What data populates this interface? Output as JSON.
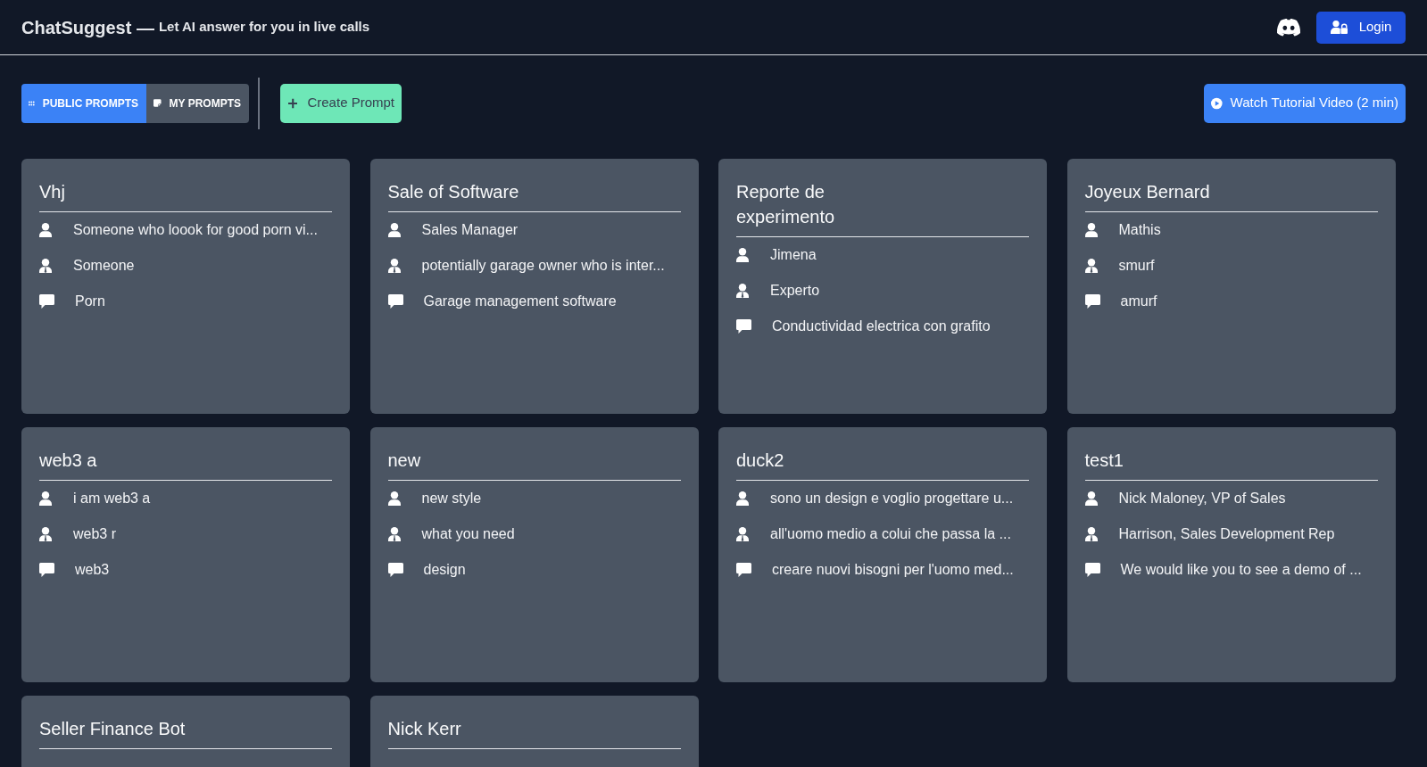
{
  "header": {
    "brand": "ChatSuggest —",
    "tagline": "Let AI answer for you in live calls",
    "login_button": "Login"
  },
  "toolbar": {
    "tabs": [
      {
        "label": "PUBLIC PROMPTS",
        "kind": "grid",
        "selected": true
      },
      {
        "label": "MY PROMPTS",
        "kind": "note",
        "selected": false
      }
    ],
    "create_button": "Create Prompt",
    "tutorial_button": "Watch Tutorial Video (2 min)"
  },
  "prompts": [
    {
      "title": "Vhj",
      "lines": [
        {
          "kind": "user",
          "text": "Someone who loook for good porn vi..."
        },
        {
          "kind": "persona",
          "text": "Someone"
        },
        {
          "kind": "topic",
          "text": "Porn"
        }
      ]
    },
    {
      "title": "Sale of Software",
      "lines": [
        {
          "kind": "user",
          "text": "Sales Manager"
        },
        {
          "kind": "persona",
          "text": "potentially garage owner who is inter..."
        },
        {
          "kind": "topic",
          "text": "Garage management software"
        }
      ]
    },
    {
      "title": "Reporte de experimento",
      "lines": [
        {
          "kind": "user",
          "text": "Jimena"
        },
        {
          "kind": "persona",
          "text": "Experto"
        },
        {
          "kind": "topic",
          "text": "Conductividad electrica con grafito"
        }
      ]
    },
    {
      "title": "Joyeux Bernard",
      "lines": [
        {
          "kind": "user",
          "text": "Mathis"
        },
        {
          "kind": "persona",
          "text": "smurf"
        },
        {
          "kind": "topic",
          "text": "amurf"
        }
      ]
    },
    {
      "title": "web3 a",
      "lines": [
        {
          "kind": "user",
          "text": "i am web3 a"
        },
        {
          "kind": "persona",
          "text": "web3 r"
        },
        {
          "kind": "topic",
          "text": "web3"
        }
      ]
    },
    {
      "title": "new",
      "lines": [
        {
          "kind": "user",
          "text": "new style"
        },
        {
          "kind": "persona",
          "text": "what you need"
        },
        {
          "kind": "topic",
          "text": "design"
        }
      ]
    },
    {
      "title": "duck2",
      "lines": [
        {
          "kind": "user",
          "text": "sono un design e voglio progettare u..."
        },
        {
          "kind": "persona",
          "text": "all'uomo medio a colui che passa la ..."
        },
        {
          "kind": "topic",
          "text": "creare nuovi bisogni per l'uomo med..."
        }
      ]
    },
    {
      "title": "test1",
      "lines": [
        {
          "kind": "user",
          "text": "Nick Maloney, VP of Sales"
        },
        {
          "kind": "persona",
          "text": "Harrison, Sales Development Rep"
        },
        {
          "kind": "topic",
          "text": "We would like you to see a demo of ..."
        }
      ]
    },
    {
      "title": "Seller Finance Bot"
    },
    {
      "title": "Nick Kerr"
    }
  ]
}
